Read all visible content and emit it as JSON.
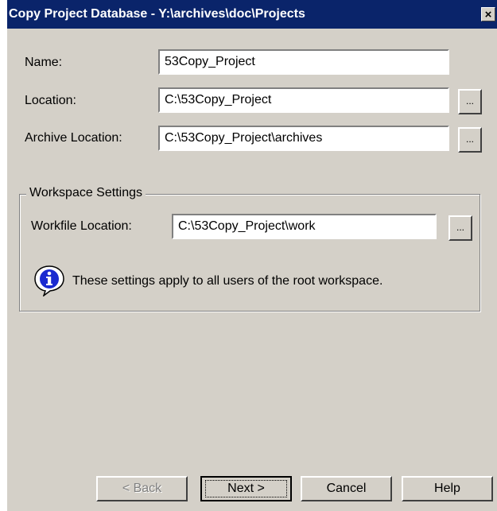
{
  "window": {
    "title": "Copy Project Database - Y:\\archives\\doc\\Projects",
    "close_label": "×"
  },
  "form": {
    "name_label": "Name:",
    "name_value": "53Copy_Project",
    "location_label": "Location:",
    "location_value": "C:\\53Copy_Project",
    "archive_label": "Archive Location:",
    "archive_value": "C:\\53Copy_Project\\archives",
    "browse_label": "..."
  },
  "workspace": {
    "group_label": "Workspace Settings",
    "workfile_label": "Workfile Location:",
    "workfile_value": "C:\\53Copy_Project\\work",
    "info_text": "These settings apply to all users of the root workspace."
  },
  "buttons": {
    "back": "< Back",
    "next": "Next >",
    "cancel": "Cancel",
    "help": "Help"
  },
  "icons": {
    "close": "close-icon",
    "info": "info-icon"
  },
  "colors": {
    "titlebar": "#0a246a",
    "dialog_bg": "#d4d0c8",
    "info_icon": "#1a2ad0"
  }
}
